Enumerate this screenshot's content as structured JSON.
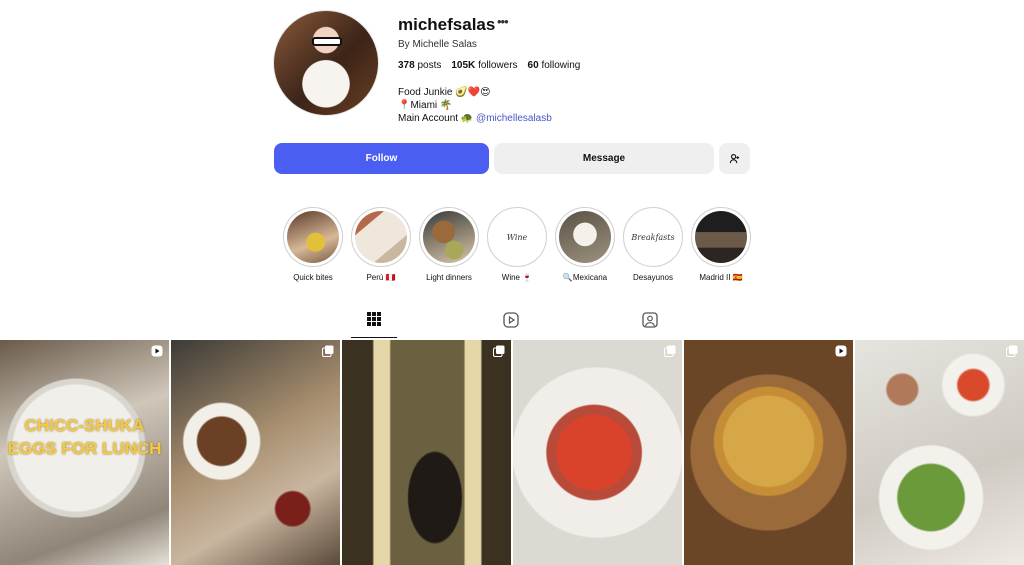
{
  "profile": {
    "username": "michefsalas",
    "byline": "By Michelle Salas",
    "posts_count": "378",
    "posts_label": "posts",
    "followers_count": "105K",
    "followers_label": "followers",
    "following_count": "60",
    "following_label": "following",
    "bio_line1": "Food Junkie 🥑❤️😍",
    "bio_line2": "📍Miami 🌴",
    "bio_line3_prefix": "Main Account 🐢",
    "bio_link": "@michellesalasb"
  },
  "actions": {
    "follow": "Follow",
    "message": "Message",
    "add_user_icon": "add-user-icon"
  },
  "highlights": [
    {
      "label": "Quick bites"
    },
    {
      "label": "Perú 🇵🇪"
    },
    {
      "label": "Light dinners"
    },
    {
      "label": "Wine 🍷",
      "cover_text": "Wine"
    },
    {
      "label": "🔍Mexicana"
    },
    {
      "label": "Desayunos",
      "cover_text": "Breakfasts"
    },
    {
      "label": "Madrid II 🇪🇸"
    }
  ],
  "tabs": [
    "grid-icon",
    "reels-icon",
    "tagged-icon"
  ],
  "posts": [
    {
      "type": "reel",
      "overlay": "CHICC-SHUKA EGGS FOR LUNCH"
    },
    {
      "type": "carousel"
    },
    {
      "type": "carousel"
    },
    {
      "type": "carousel"
    },
    {
      "type": "reel"
    },
    {
      "type": "carousel"
    }
  ],
  "colors": {
    "follow_button": "#4a5ff2",
    "secondary_button": "#efefef",
    "link": "#4a56c8"
  }
}
